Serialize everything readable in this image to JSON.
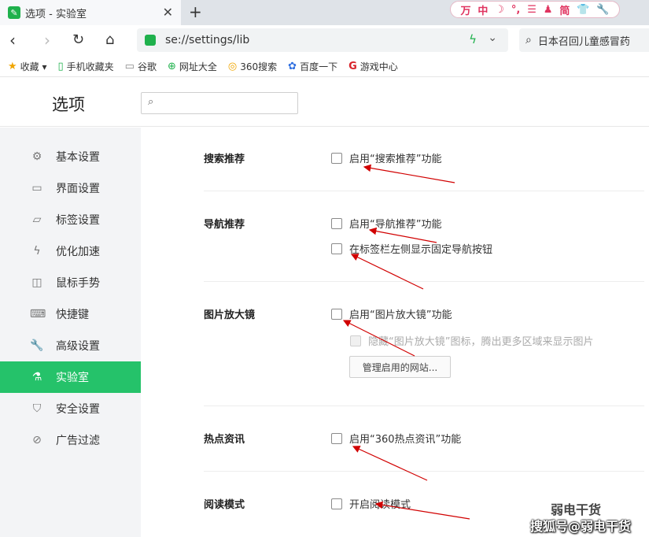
{
  "tab": {
    "title": "选项 - 实验室",
    "close": "✕",
    "new_tab": "+"
  },
  "toolstrip": [
    "万",
    "中",
    "☽",
    "°,",
    "☰",
    "♟",
    "简",
    "👕",
    "🔧"
  ],
  "address": {
    "url": "se://settings/lib",
    "search_text": "日本召回儿童感冒药"
  },
  "bookmarks": [
    {
      "icon": "★",
      "label": "收藏 ▾"
    },
    {
      "icon": "▯",
      "label": "手机收藏夹"
    },
    {
      "icon": "▭",
      "label": "谷歌"
    },
    {
      "icon": "⊕",
      "label": "网址大全"
    },
    {
      "icon": "◎",
      "label": "360搜索"
    },
    {
      "icon": "✿",
      "label": "百度一下"
    },
    {
      "icon": "G",
      "label": "游戏中心"
    }
  ],
  "header": {
    "title": "选项",
    "search_placeholder": ""
  },
  "sidebar": [
    {
      "icon": "⚙",
      "label": "基本设置"
    },
    {
      "icon": "▭",
      "label": "界面设置"
    },
    {
      "icon": "▱",
      "label": "标签设置"
    },
    {
      "icon": "ϟ",
      "label": "优化加速"
    },
    {
      "icon": "◫",
      "label": "鼠标手势"
    },
    {
      "icon": "⌨",
      "label": "快捷键"
    },
    {
      "icon": "🔧",
      "label": "高级设置"
    },
    {
      "icon": "⚗",
      "label": "实验室"
    },
    {
      "icon": "⛉",
      "label": "安全设置"
    },
    {
      "icon": "⊘",
      "label": "广告过滤"
    }
  ],
  "sections": {
    "search": {
      "title": "搜索推荐",
      "opt1": "启用“搜索推荐”功能"
    },
    "nav": {
      "title": "导航推荐",
      "opt1": "启用“导航推荐”功能",
      "opt2": "在标签栏左侧显示固定导航按钮"
    },
    "magnifier": {
      "title": "图片放大镜",
      "opt1": "启用“图片放大镜”功能",
      "opt2": "隐藏“图片放大镜”图标，腾出更多区域来显示图片",
      "manage": "管理启用的网站..."
    },
    "hotnews": {
      "title": "热点资讯",
      "opt1": "启用“360热点资讯”功能"
    },
    "reading": {
      "title": "阅读模式",
      "opt1": "开启阅读模式"
    }
  },
  "watermark": {
    "line1": "弱电干货",
    "line2": "搜狐号@弱电干货"
  }
}
